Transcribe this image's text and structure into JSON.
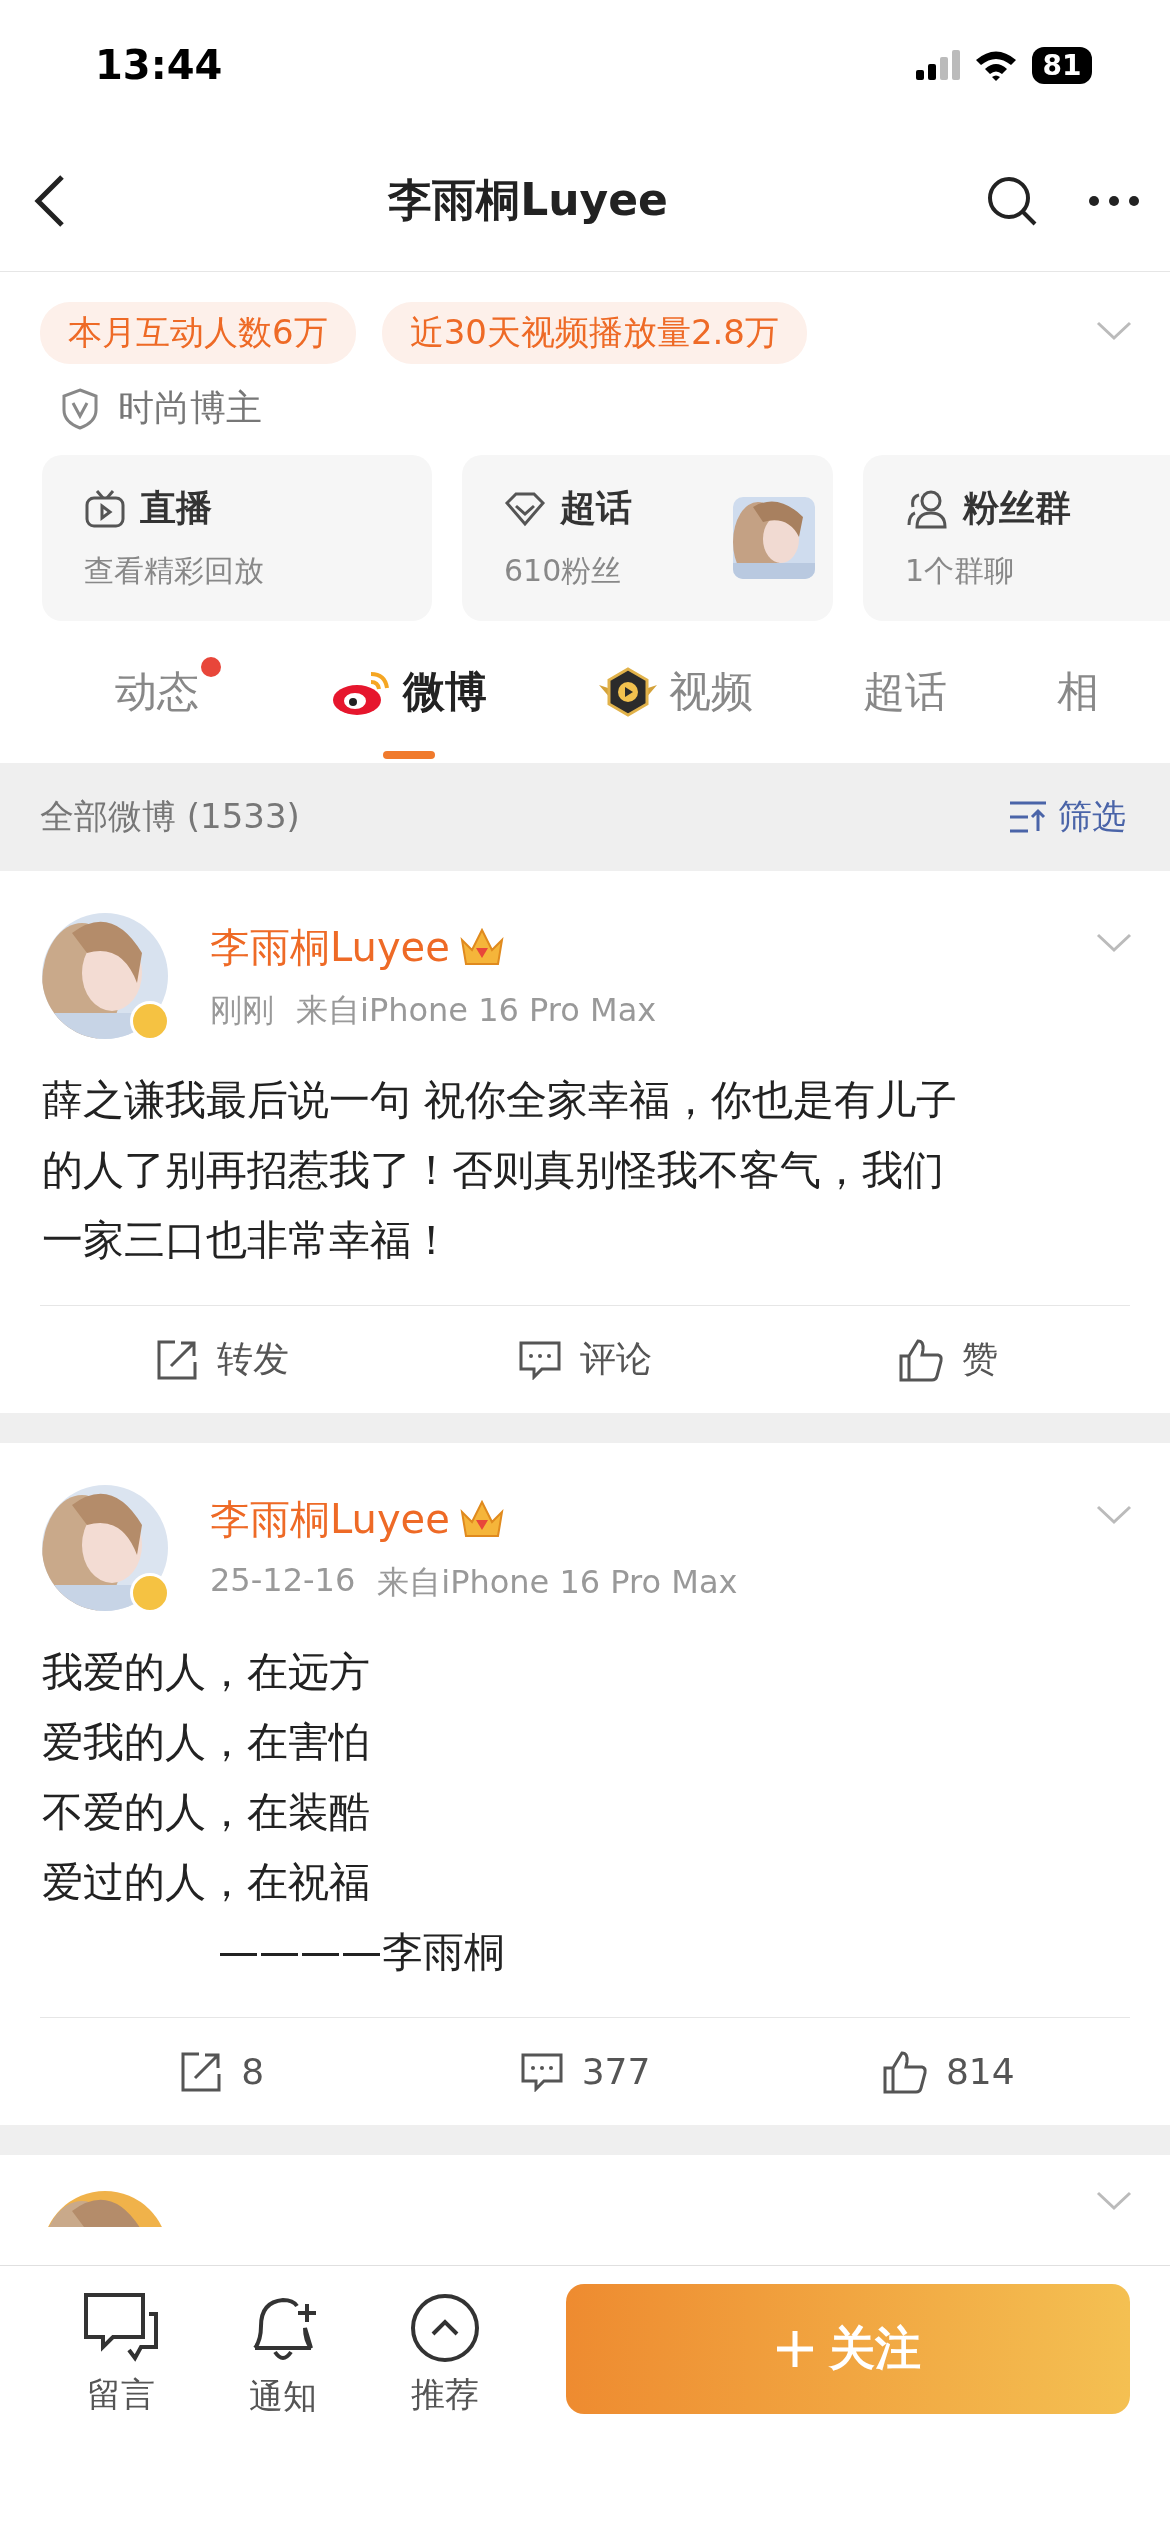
{
  "status_bar": {
    "time": "13:44",
    "battery": "81"
  },
  "nav": {
    "title": "李雨桐Luyee"
  },
  "stats_tags": [
    "本月互动人数6万",
    "近30天视频播放量2.8万"
  ],
  "category": "时尚博主",
  "cards": [
    {
      "kind": "live",
      "title": "直播",
      "subtitle": "查看精彩回放"
    },
    {
      "kind": "topic",
      "title": "超话",
      "subtitle": "610粉丝"
    },
    {
      "kind": "fans",
      "title": "粉丝群",
      "subtitle": "1个群聊"
    }
  ],
  "tabs": [
    {
      "kind": "plain",
      "label": "动态",
      "selected": false,
      "badge": true
    },
    {
      "kind": "weibo",
      "label": "微博",
      "selected": true,
      "badge": false
    },
    {
      "kind": "video",
      "label": "视频",
      "selected": false,
      "badge": false
    },
    {
      "kind": "plain",
      "label": "超话",
      "selected": false,
      "badge": false
    },
    {
      "kind": "plain",
      "label": "相",
      "selected": false,
      "badge": false
    }
  ],
  "filter_bar": {
    "count_label": "全部微博 (1533)",
    "filter": "筛选"
  },
  "posts": [
    {
      "author": "李雨桐Luyee",
      "time": "刚刚",
      "source": "来自iPhone 16 Pro Max",
      "lines": [
        {
          "kind": "text",
          "text": "薛之谦我最后说一句 祝你全家幸福，你也是有儿子"
        },
        {
          "kind": "text",
          "text": "的人了别再招惹我了！否则真别怪我不客气，我们"
        },
        {
          "kind": "text",
          "text": "一家三口也非常幸福！"
        }
      ],
      "actions": [
        {
          "kind": "repost",
          "label": "转发"
        },
        {
          "kind": "comment",
          "label": "评论"
        },
        {
          "kind": "like",
          "label": "赞"
        }
      ]
    },
    {
      "author": "李雨桐Luyee",
      "time": "25-12-16",
      "source": "来自iPhone 16 Pro Max",
      "lines": [
        {
          "kind": "text",
          "text": "我爱的人，在远方"
        },
        {
          "kind": "text",
          "text": "爱我的人，在害怕"
        },
        {
          "kind": "text",
          "text": "不爱的人，在装酷"
        },
        {
          "kind": "text",
          "text": "爱过的人，在祝福"
        },
        {
          "kind": "signature",
          "text": "————李雨桐"
        }
      ],
      "actions": [
        {
          "kind": "repost",
          "label": "8"
        },
        {
          "kind": "comment",
          "label": "377"
        },
        {
          "kind": "like",
          "label": "814"
        }
      ]
    }
  ],
  "bottom_bar": {
    "actions": [
      {
        "kind": "message",
        "label": "留言"
      },
      {
        "kind": "notify",
        "label": "通知"
      },
      {
        "kind": "recommend",
        "label": "推荐"
      }
    ],
    "follow": "关注"
  }
}
